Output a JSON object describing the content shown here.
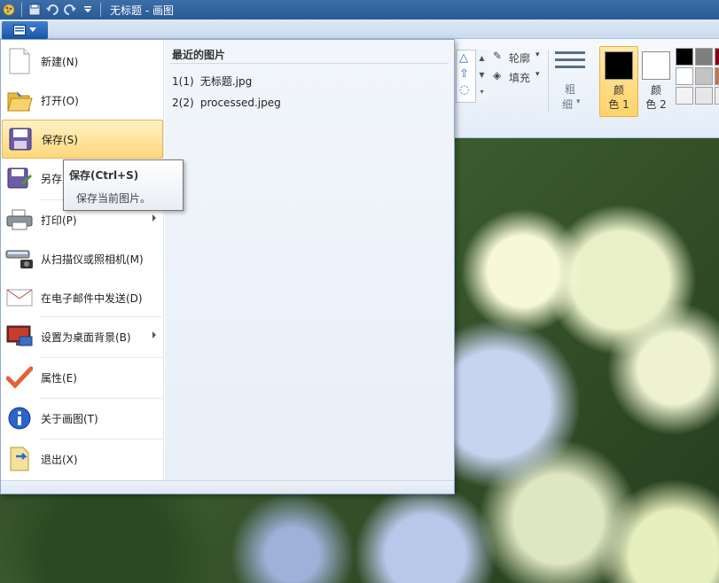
{
  "window": {
    "title": "无标题 - 画图"
  },
  "quick_access": {
    "icons": [
      "paint-app-icon",
      "save-icon",
      "undo-icon",
      "redo-icon",
      "customize-dropdown-icon"
    ]
  },
  "ribbon": {
    "outline_label": "轮廓",
    "fill_label": "填充",
    "size_label_top": "粗",
    "size_label_bottom": "细",
    "color1_top": "颜",
    "color1_bottom": "色 1",
    "color2_top": "颜",
    "color2_bottom": "色 2",
    "color1_value": "#000000",
    "color2_value": "#ffffff",
    "palette": [
      "#000000",
      "#7f7f7f",
      "#880015",
      "#ffffff",
      "#c3c3c3",
      "#b97a57",
      "#f2f2f2",
      "#e6e6e6",
      "#ededed"
    ]
  },
  "file_menu": {
    "items": [
      {
        "label": "新建(N)",
        "icon": "new-document-icon"
      },
      {
        "label": "打开(O)",
        "icon": "open-folder-icon"
      },
      {
        "label": "保存(S)",
        "icon": "save-icon"
      },
      {
        "label": "另存为",
        "icon": "save-as-icon"
      },
      {
        "label": "打印(P)",
        "icon": "printer-icon"
      },
      {
        "label": "从扫描仪或照相机(M)",
        "icon": "scanner-icon"
      },
      {
        "label": "在电子邮件中发送(D)",
        "icon": "email-icon"
      },
      {
        "label": "设置为桌面背景(B)",
        "icon": "desktop-background-icon"
      },
      {
        "label": "属性(E)",
        "icon": "properties-checkmark-icon"
      },
      {
        "label": "关于画图(T)",
        "icon": "info-icon"
      },
      {
        "label": "退出(X)",
        "icon": "exit-icon"
      }
    ],
    "recent_header": "最近的图片",
    "recent": [
      {
        "num": "1(1)",
        "name": "无标题.jpg"
      },
      {
        "num": "2(2)",
        "name": "processed.jpeg"
      }
    ]
  },
  "tooltip": {
    "title": "保存(Ctrl+S)",
    "body": "保存当前图片。"
  }
}
